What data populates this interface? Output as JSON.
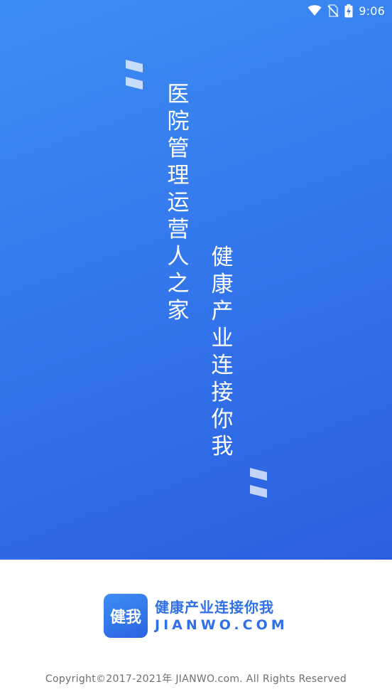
{
  "status_bar": {
    "time": "9:06",
    "icons": [
      "wifi-icon",
      "no-sim-icon",
      "battery-charging-icon"
    ]
  },
  "splash": {
    "slogan_primary": "医院管理运营人之家",
    "slogan_secondary": "健康产业连接你我",
    "background_colors": [
      "#3d8ef3",
      "#2b5fe0"
    ]
  },
  "footer": {
    "logo_text": "健我",
    "brand_slogan": "健康产业连接你我",
    "brand_domain": "JIANWO.COM",
    "copyright": "Copyright©2017-2021年 JIANWO.com. All Rights Reserved",
    "brand_color": "#2f6fe8"
  }
}
